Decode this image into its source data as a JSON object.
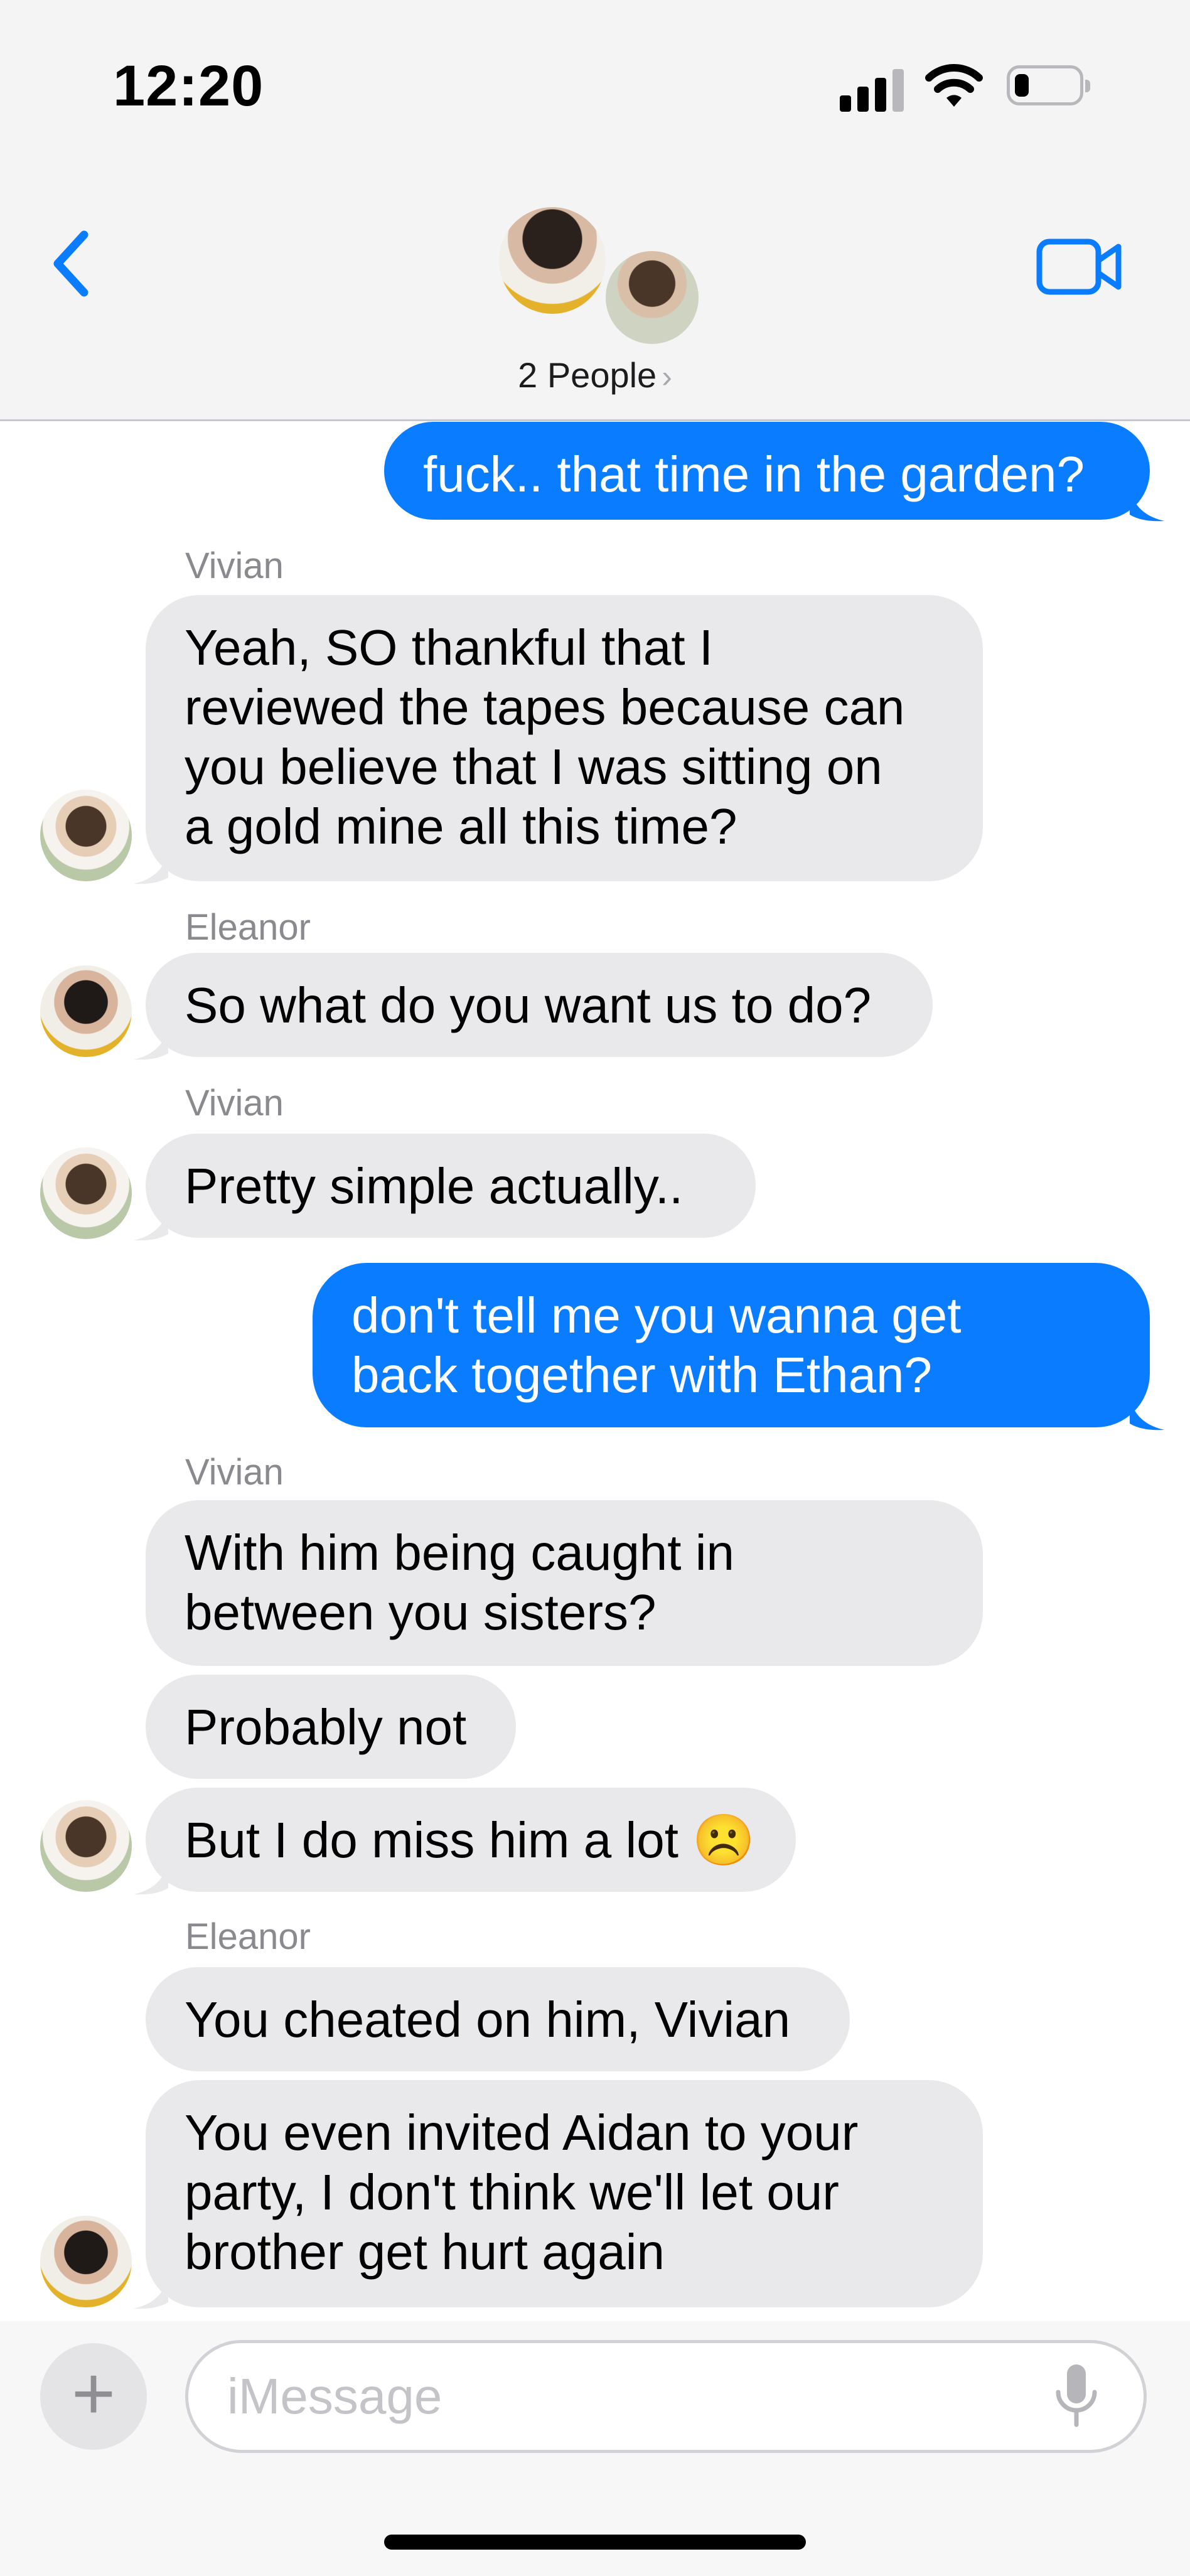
{
  "status_bar": {
    "time": "12:20"
  },
  "header": {
    "group_name": "2 People",
    "chevron": "›"
  },
  "messages": [
    {
      "type": "out",
      "text": "fuck.. that time in the garden?"
    },
    {
      "type": "sender",
      "text": "Vivian"
    },
    {
      "type": "in",
      "lines": [
        "Yeah, SO thankful that I",
        "reviewed the tapes because can",
        "you believe that I was sitting on",
        "a gold mine all this time?"
      ]
    },
    {
      "type": "sender",
      "text": "Eleanor"
    },
    {
      "type": "in",
      "text": "So what do you want us to do?"
    },
    {
      "type": "sender",
      "text": "Vivian"
    },
    {
      "type": "in",
      "text": "Pretty simple actually.."
    },
    {
      "type": "out",
      "lines": [
        "don't tell me you wanna get",
        "back together with Ethan?"
      ]
    },
    {
      "type": "sender",
      "text": "Vivian"
    },
    {
      "type": "in",
      "lines": [
        "With him being caught in",
        "between you sisters?"
      ]
    },
    {
      "type": "in",
      "text": "Probably not"
    },
    {
      "type": "in",
      "text": "But I do miss him a lot ☹️"
    },
    {
      "type": "sender",
      "text": "Eleanor"
    },
    {
      "type": "in",
      "text": "You cheated on him, Vivian"
    },
    {
      "type": "in",
      "lines": [
        "You even invited Aidan to your",
        "party, I don't think we'll let our",
        "brother get hurt again"
      ]
    }
  ],
  "composer": {
    "placeholder": "iMessage",
    "plus": "+"
  },
  "colors": {
    "outgoing_bubble": "#0a7cff",
    "incoming_bubble": "#e9e9eb",
    "accent": "#0a7cff"
  },
  "icons": [
    "back-chevron-icon",
    "video-camera-icon",
    "cellular-signal-icon",
    "wifi-icon",
    "battery-icon",
    "plus-icon",
    "microphone-icon"
  ]
}
